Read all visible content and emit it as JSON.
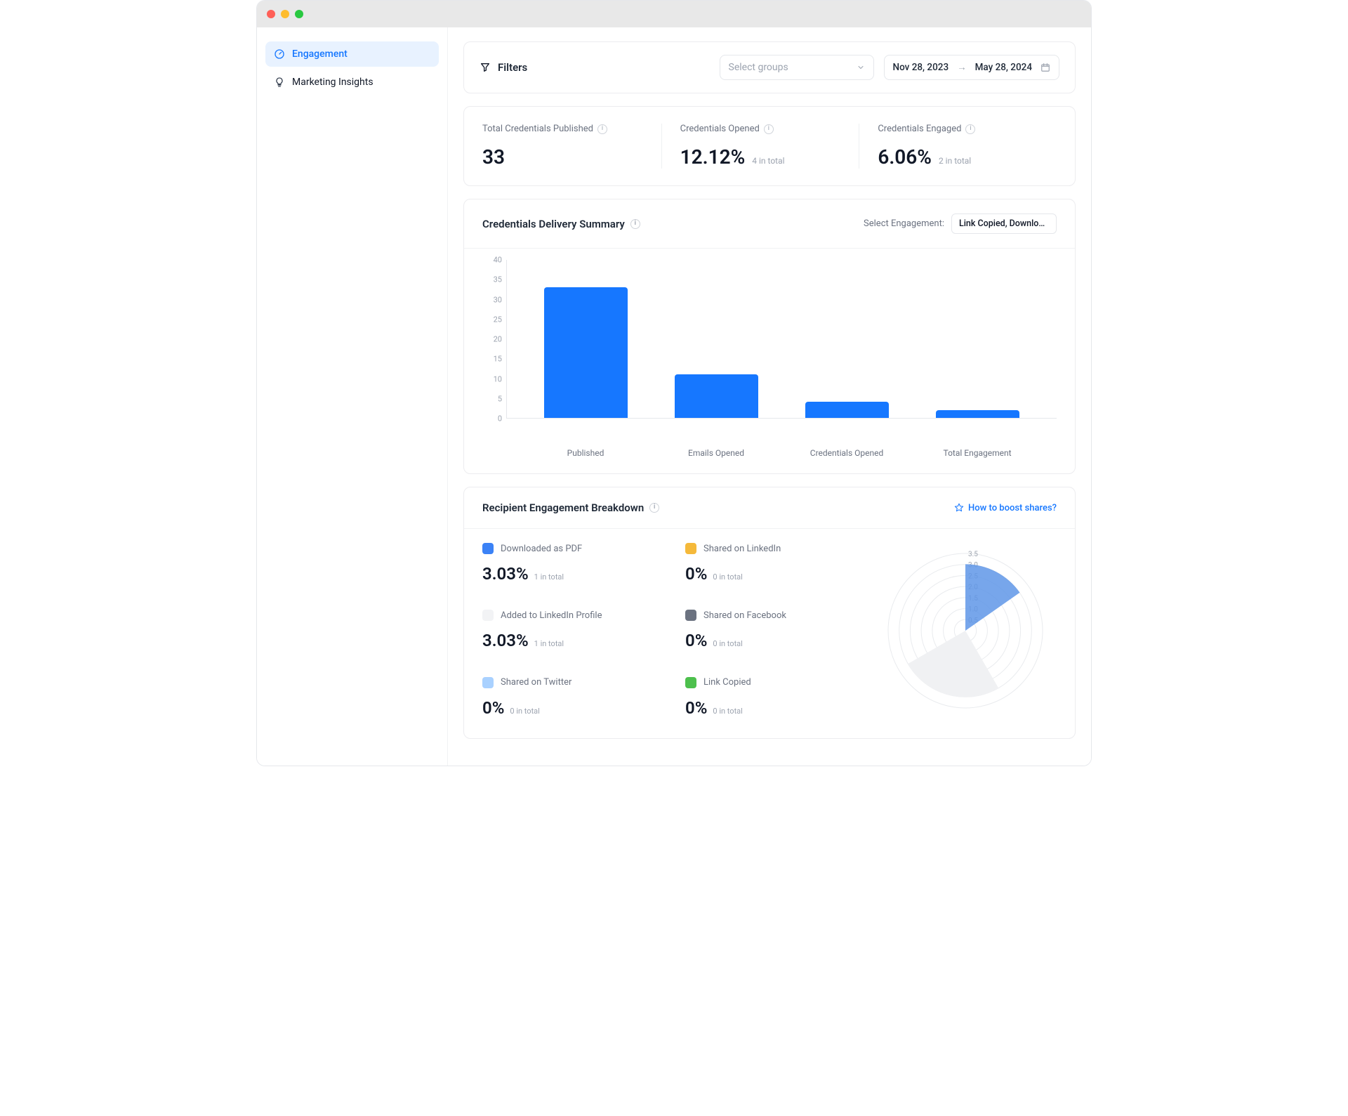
{
  "sidebar": {
    "items": [
      {
        "label": "Engagement",
        "active": true
      },
      {
        "label": "Marketing Insights",
        "active": false
      }
    ]
  },
  "filters": {
    "title": "Filters",
    "groups_placeholder": "Select groups",
    "date_from": "Nov 28, 2023",
    "date_to": "May 28, 2024"
  },
  "stats": [
    {
      "label": "Total Credentials Published",
      "value": "33",
      "sub": ""
    },
    {
      "label": "Credentials Opened",
      "value": "12.12%",
      "sub": "4 in total"
    },
    {
      "label": "Credentials Engaged",
      "value": "6.06%",
      "sub": "2 in total"
    }
  ],
  "delivery": {
    "title": "Credentials Delivery Summary",
    "select_label": "Select Engagement:",
    "select_value": "Link Copied, Downloade…"
  },
  "chart_data": {
    "type": "bar",
    "categories": [
      "Published",
      "Emails Opened",
      "Credentials Opened",
      "Total Engagement"
    ],
    "values": [
      33,
      11,
      4,
      2
    ],
    "ylim": [
      0,
      40
    ],
    "yticks": [
      0,
      5,
      10,
      15,
      20,
      25,
      30,
      35,
      40
    ],
    "xlabel": "",
    "ylabel": "",
    "title": "Credentials Delivery Summary"
  },
  "breakdown": {
    "title": "Recipient Engagement Breakdown",
    "boost_link": "How to boost shares?",
    "items": [
      {
        "label": "Downloaded as PDF",
        "value": "3.03%",
        "sub": "1 in total",
        "color": "#3b82f6"
      },
      {
        "label": "Shared on LinkedIn",
        "value": "0%",
        "sub": "0 in total",
        "color": "#f5b93a"
      },
      {
        "label": "Added to LinkedIn Profile",
        "value": "3.03%",
        "sub": "1 in total",
        "color": "#f2f3f5"
      },
      {
        "label": "Shared on Facebook",
        "value": "0%",
        "sub": "0 in total",
        "color": "#6b7280"
      },
      {
        "label": "Shared on Twitter",
        "value": "0%",
        "sub": "0 in total",
        "color": "#a9d1ff"
      },
      {
        "label": "Link Copied",
        "value": "0%",
        "sub": "0 in total",
        "color": "#4dc04d"
      }
    ],
    "radar": {
      "ticks": [
        "0.5",
        "1.0",
        "1.5",
        "2.0",
        "2.5",
        "3.0",
        "3.5"
      ]
    }
  }
}
